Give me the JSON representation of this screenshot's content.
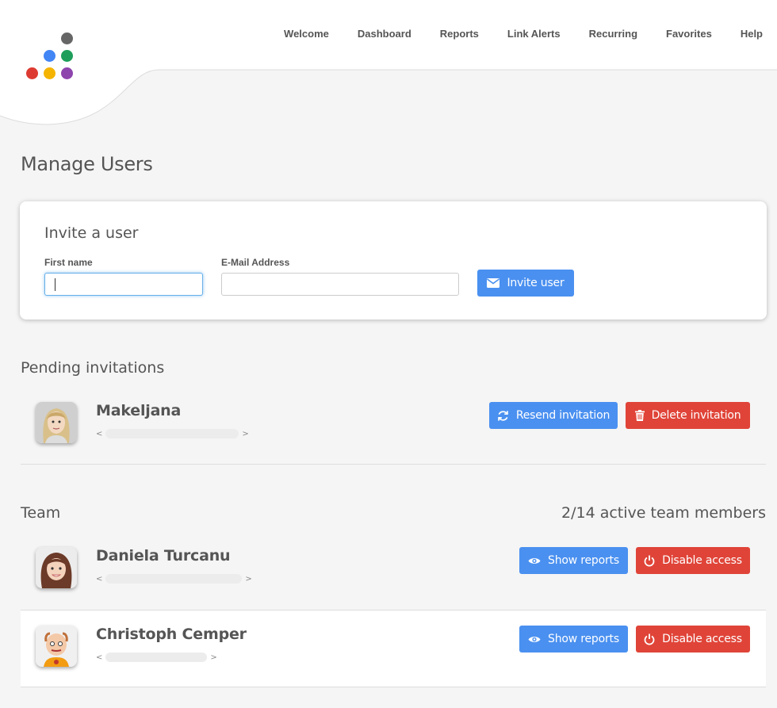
{
  "nav": {
    "items": [
      "Welcome",
      "Dashboard",
      "Reports",
      "Link Alerts",
      "Recurring",
      "Favorites",
      "Help"
    ]
  },
  "logo": {
    "dot_colors": [
      "#666666",
      "#4285f4",
      "#1e9e5a",
      "#dd3b32",
      "#f4b400",
      "#8e44ad"
    ]
  },
  "page": {
    "title": "Manage Users"
  },
  "invite": {
    "title": "Invite a user",
    "first_name_label": "First name",
    "first_name_value": "",
    "email_label": "E-Mail Address",
    "email_value": "",
    "button_label": "Invite user",
    "button_icon": "envelope-icon"
  },
  "pending": {
    "title": "Pending invitations",
    "items": [
      {
        "name": "Makeljana",
        "email_prefix": "<",
        "email_suffix": ">",
        "resend_label": "Resend invitation",
        "delete_label": "Delete invitation"
      }
    ]
  },
  "team": {
    "title": "Team",
    "count_text": "2/14 active team members",
    "members": [
      {
        "name": "Daniela Turcanu",
        "email_prefix": "<",
        "email_suffix": ">",
        "show_label": "Show reports",
        "disable_label": "Disable access"
      },
      {
        "name": "Christoph Cemper",
        "email_prefix": "<",
        "email_suffix": ">",
        "show_label": "Show reports",
        "disable_label": "Disable access"
      }
    ]
  },
  "colors": {
    "primary": "#4a90f0",
    "danger": "#e04438",
    "background": "#f5f5f5"
  }
}
